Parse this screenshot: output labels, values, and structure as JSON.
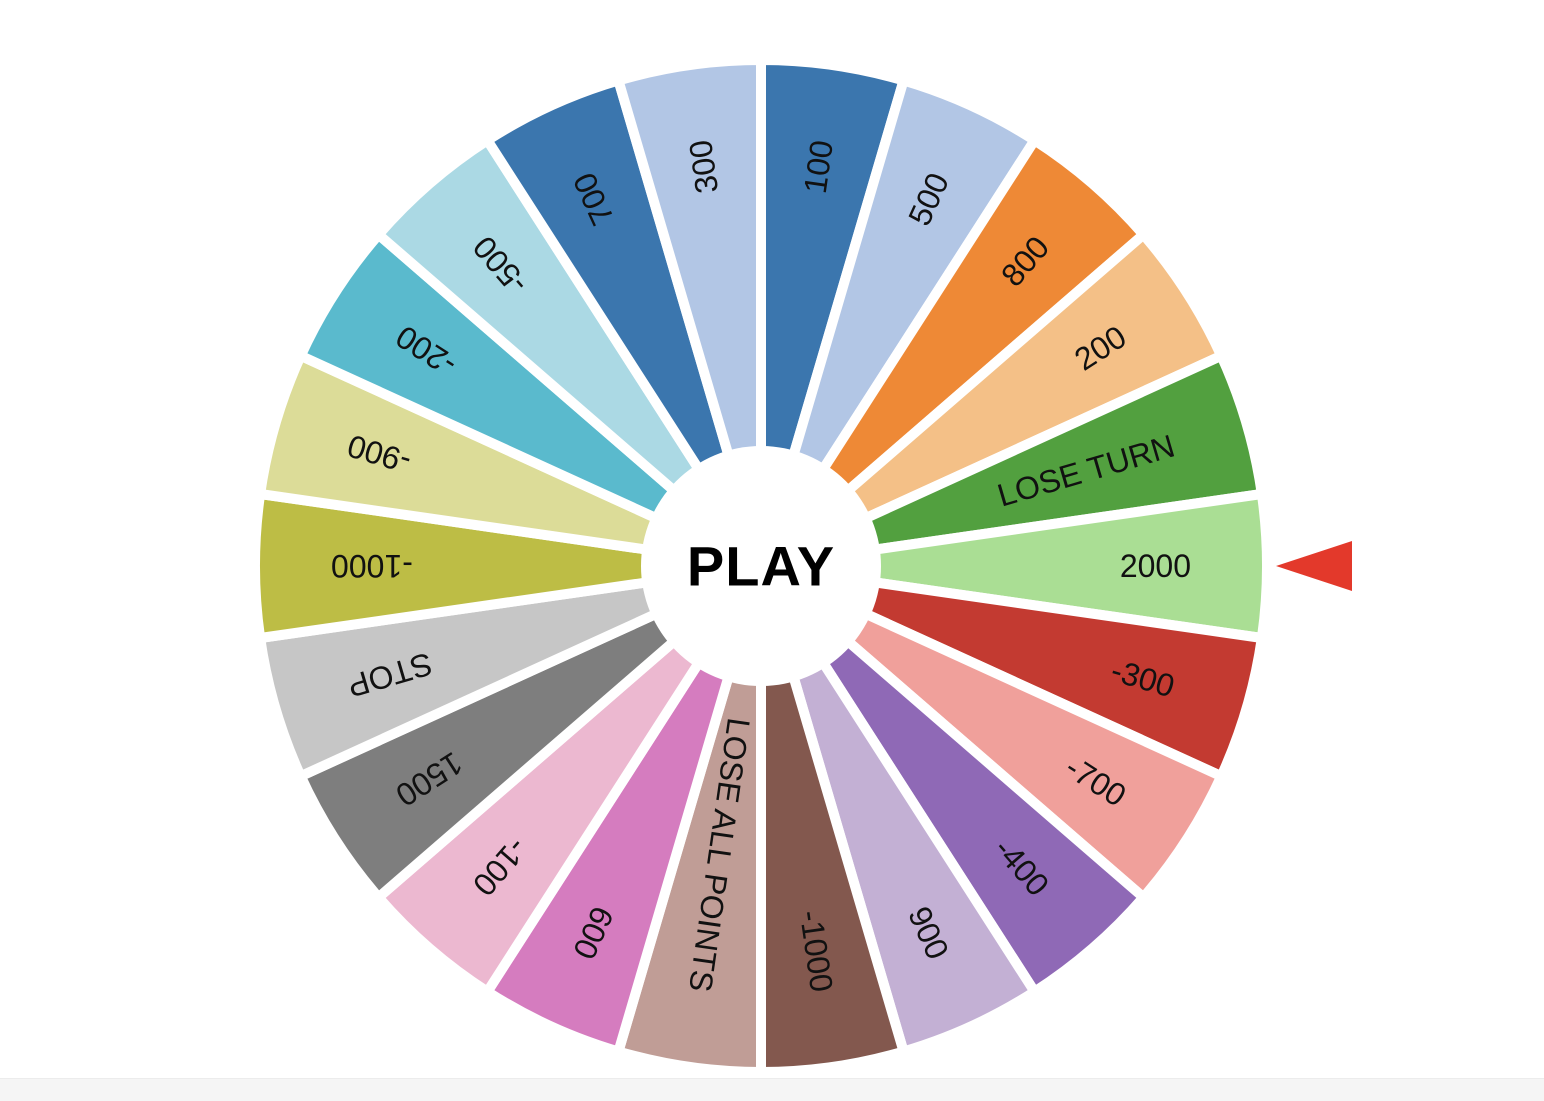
{
  "wheel": {
    "segments": [
      {
        "label": "100",
        "color": "#3b76ae"
      },
      {
        "label": "500",
        "color": "#b2c6e5"
      },
      {
        "label": "800",
        "color": "#ee8936"
      },
      {
        "label": "200",
        "color": "#f4c087"
      },
      {
        "label": "LOSE TURN",
        "color": "#52a03f"
      },
      {
        "label": "2000",
        "color": "#aade94"
      },
      {
        "label": "-300",
        "color": "#c33a31"
      },
      {
        "label": "-700",
        "color": "#f0a09b"
      },
      {
        "label": "-400",
        "color": "#8f69b6"
      },
      {
        "label": "900",
        "color": "#c3b0d4"
      },
      {
        "label": "-1000",
        "color": "#83584e"
      },
      {
        "label": "LOSE ALL POINTS",
        "color": "#c09d96"
      },
      {
        "label": "600",
        "color": "#d57cbf"
      },
      {
        "label": "-100",
        "color": "#ecb8d0"
      },
      {
        "label": "1500",
        "color": "#7e7e7e"
      },
      {
        "label": "STOP",
        "color": "#c6c6c6"
      },
      {
        "label": "-1000",
        "color": "#bdbd45"
      },
      {
        "label": "-900",
        "color": "#dcdc98"
      },
      {
        "label": "-200",
        "color": "#5abacd"
      },
      {
        "label": "-500",
        "color": "#abd9e4"
      },
      {
        "label": "700",
        "color": "#3b76ae"
      },
      {
        "label": "300",
        "color": "#b2c6e5"
      }
    ],
    "divider_color": "#ffffff",
    "play_button": {
      "label": "PLAY",
      "background": "#ffffff"
    },
    "pointer": {
      "color": "#e3392b"
    }
  }
}
